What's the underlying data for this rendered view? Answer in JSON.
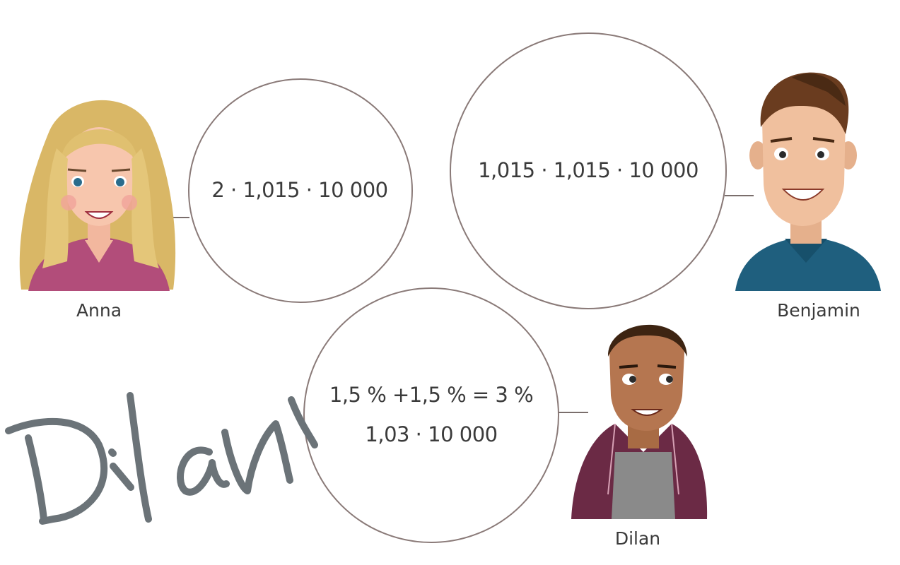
{
  "people": {
    "anna": {
      "name": "Anna",
      "expression": "2 · 1,015 · 10 000"
    },
    "benjamin": {
      "name": "Benjamin",
      "expression": "1,015 · 1,015 · 10 000"
    },
    "dilan": {
      "name": "Dilan",
      "expression_line1": "1,5 % +1,5 % = 3 %",
      "expression_line2": "1,03 · 10 000"
    }
  },
  "handwriting": "Dilan",
  "colors": {
    "circle_stroke": "#8a7a78",
    "handwriting": "#6b7378",
    "text": "#3b3b3b"
  }
}
